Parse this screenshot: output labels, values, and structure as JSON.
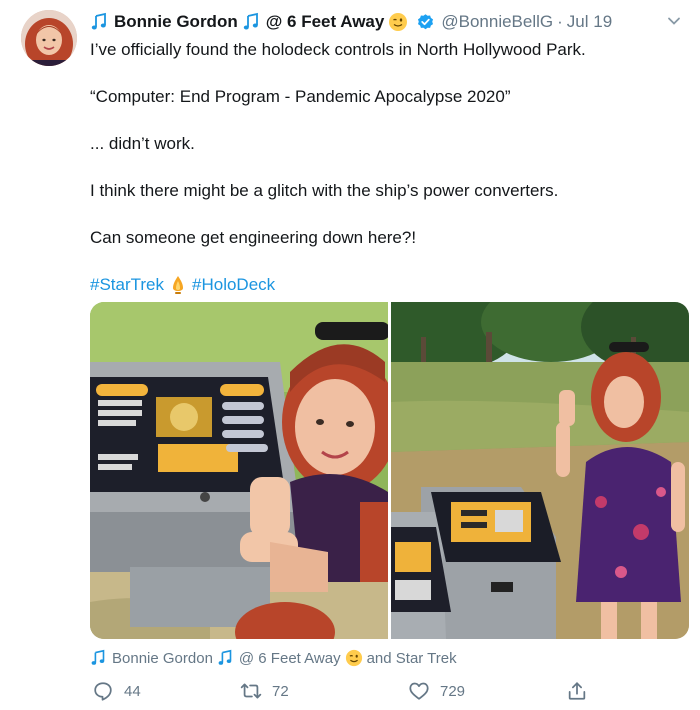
{
  "tweet": {
    "author_name": "Bonnie Gordon",
    "author_suffix": "@ 6 Feet Away",
    "handle": "@BonnieBellG",
    "separator": "·",
    "date": "Jul 19",
    "lines": [
      "I’ve officially found the holodeck controls in North Hollywood Park.",
      "“Computer: End Program - Pandemic Apocalypse 2020”",
      "... didn’t work.",
      "I think there might be a glitch with the ship’s power converters.",
      "Can someone get engineering down here?!"
    ],
    "hashtags": [
      "#StarTrek",
      "#HoloDeck"
    ]
  },
  "context": {
    "name": "Bonnie Gordon",
    "suffix": "@ 6 Feet Away",
    "and_text": "and Star Trek"
  },
  "actions": {
    "replies": "44",
    "retweets": "72",
    "likes": "729"
  },
  "colors": {
    "link": "#1b95e0",
    "muted": "#657786",
    "verified": "#1da1f2"
  }
}
